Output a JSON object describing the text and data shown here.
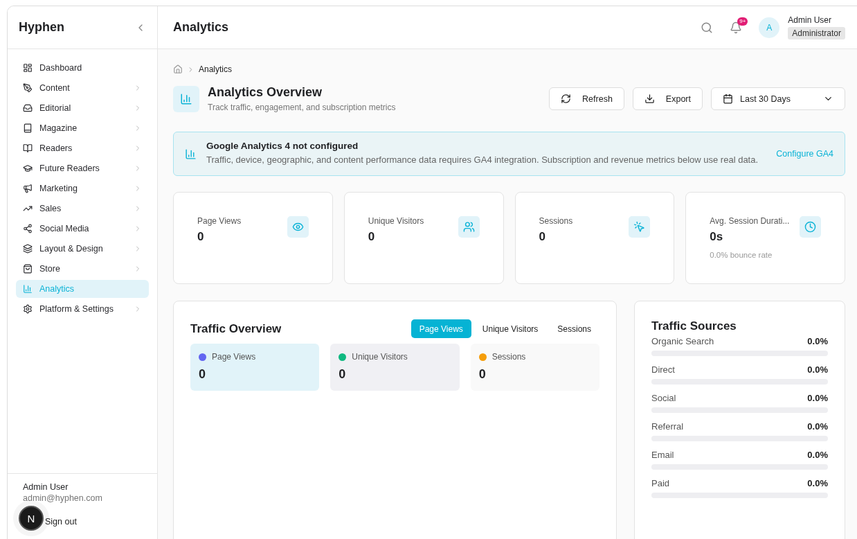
{
  "sidebar": {
    "brand": "Hyphen",
    "items": [
      {
        "label": "Dashboard",
        "has_submenu": false,
        "selected": false
      },
      {
        "label": "Content",
        "has_submenu": true,
        "selected": false
      },
      {
        "label": "Editorial",
        "has_submenu": true,
        "selected": false
      },
      {
        "label": "Magazine",
        "has_submenu": true,
        "selected": false
      },
      {
        "label": "Readers",
        "has_submenu": true,
        "selected": false
      },
      {
        "label": "Future Readers",
        "has_submenu": true,
        "selected": false
      },
      {
        "label": "Marketing",
        "has_submenu": true,
        "selected": false
      },
      {
        "label": "Sales",
        "has_submenu": true,
        "selected": false
      },
      {
        "label": "Social Media",
        "has_submenu": true,
        "selected": false
      },
      {
        "label": "Layout & Design",
        "has_submenu": true,
        "selected": false
      },
      {
        "label": "Store",
        "has_submenu": true,
        "selected": false
      },
      {
        "label": "Analytics",
        "has_submenu": false,
        "selected": true
      },
      {
        "label": "Platform & Settings",
        "has_submenu": true,
        "selected": false
      }
    ],
    "user": {
      "name": "Admin User",
      "email": "admin@hyphen.com"
    },
    "sign_out": "Sign out"
  },
  "dev_badge": {
    "label": "N"
  },
  "header": {
    "title": "Analytics",
    "notification_badge": "9+",
    "avatar": "A",
    "user_name": "Admin User",
    "user_role": "Administrator"
  },
  "breadcrumb": [
    "Analytics"
  ],
  "page": {
    "title": "Analytics Overview",
    "subtitle": "Track traffic, engagement, and subscription metrics",
    "buttons": [
      "Refresh",
      "Export"
    ],
    "date_range": "Last 30 Days"
  },
  "alert": {
    "title": "Google Analytics 4 not configured",
    "message": "Traffic, device, geographic, and content performance data requires GA4 integration. Subscription and revenue metrics below use real data.",
    "action": "Configure GA4"
  },
  "stats": [
    {
      "label": "Page Views",
      "value": "0"
    },
    {
      "label": "Unique Visitors",
      "value": "0"
    },
    {
      "label": "Sessions",
      "value": "0"
    },
    {
      "label": "Avg. Session Durati...",
      "value": "0s",
      "note": "0.0% bounce rate"
    }
  ],
  "traffic_overview": {
    "title": "Traffic Overview",
    "tabs": [
      {
        "label": "Page Views",
        "selected": true
      },
      {
        "label": "Unique Visitors",
        "selected": false
      },
      {
        "label": "Sessions",
        "selected": false
      }
    ],
    "legend": [
      {
        "label": "Page Views",
        "value": "0",
        "color": "#6366f1"
      },
      {
        "label": "Unique Visitors",
        "value": "0",
        "color": "#10b981"
      },
      {
        "label": "Sessions",
        "value": "0",
        "color": "#f59e0b"
      }
    ]
  },
  "traffic_sources": {
    "title": "Traffic Sources",
    "rows": [
      {
        "label": "Organic Search",
        "reading": "0.0%",
        "level": 0
      },
      {
        "label": "Direct",
        "reading": "0.0%",
        "level": 0
      },
      {
        "label": "Social",
        "reading": "0.0%",
        "level": 0
      },
      {
        "label": "Referral",
        "reading": "0.0%",
        "level": 0
      },
      {
        "label": "Email",
        "reading": "0.0%",
        "level": 0
      },
      {
        "label": "Paid",
        "reading": "0.0%",
        "level": 0
      }
    ]
  }
}
